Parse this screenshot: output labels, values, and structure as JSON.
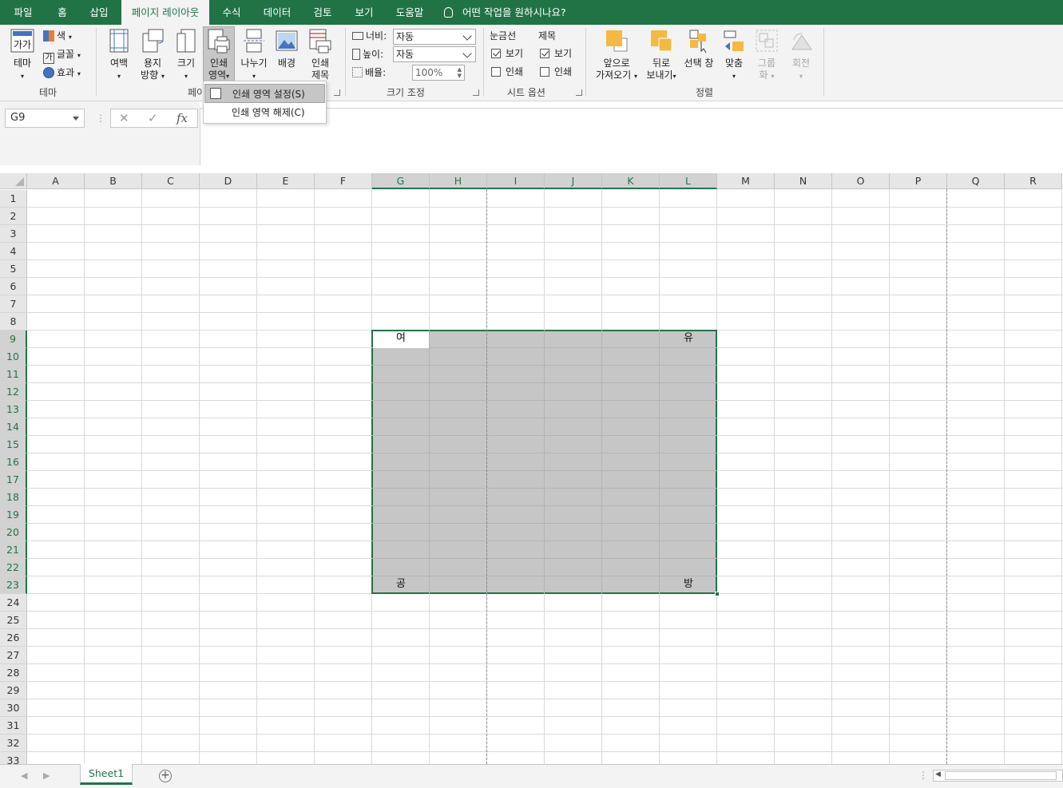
{
  "menu": {
    "tabs": [
      "파일",
      "홈",
      "삽입",
      "페이지 레이아웃",
      "수식",
      "데이터",
      "검토",
      "보기",
      "도움말"
    ],
    "active_tab": "페이지 레이아웃",
    "tell_me": "어떤 작업을 원하시나요?"
  },
  "ribbon": {
    "theme": {
      "button": "테마",
      "colors": "색",
      "fonts": "글꼴",
      "effects": "효과",
      "group": "테마"
    },
    "page_setup": {
      "margins": "여백",
      "orientation_1": "용지",
      "orientation_2": "방향",
      "size": "크기",
      "print_area_1": "인쇄",
      "print_area_2": "영역",
      "breaks": "나누기",
      "background": "배경",
      "print_titles_1": "인쇄",
      "print_titles_2": "제목",
      "group": "페이"
    },
    "scale_to_fit": {
      "width_label": "너비:",
      "width_value": "자동",
      "height_label": "높이:",
      "height_value": "자동",
      "scale_label": "배율:",
      "scale_value": "100%",
      "group": "크기 조정"
    },
    "sheet_options": {
      "gridlines": "눈금선",
      "headings": "제목",
      "view": "보기",
      "print": "인쇄",
      "group": "시트 옵션"
    },
    "arrange": {
      "bring_forward_1": "앞으로",
      "bring_forward_2": "가져오기",
      "send_backward_1": "뒤로",
      "send_backward_2": "보내기",
      "selection_pane": "선택 창",
      "align": "맞춤",
      "group_1": "그룹",
      "group_2": "화",
      "rotate": "회전",
      "group": "정렬"
    }
  },
  "print_area_menu": {
    "set": "인쇄 영역 설정(S)",
    "clear": "인쇄 영역 해제(C)"
  },
  "formula_bar": {
    "name_box": "G9",
    "cancel": "✕",
    "enter": "✓",
    "fx": "fx"
  },
  "grid": {
    "columns": [
      "A",
      "B",
      "C",
      "D",
      "E",
      "F",
      "G",
      "H",
      "I",
      "J",
      "K",
      "L",
      "M",
      "N",
      "O",
      "P",
      "Q",
      "R"
    ],
    "rows": [
      "1",
      "2",
      "3",
      "4",
      "5",
      "6",
      "7",
      "8",
      "9",
      "10",
      "11",
      "12",
      "13",
      "14",
      "15",
      "16",
      "17",
      "18",
      "19",
      "20",
      "21",
      "22",
      "23",
      "24",
      "25",
      "26",
      "27",
      "28",
      "29",
      "30",
      "31",
      "32",
      "33"
    ],
    "cells": {
      "G9": "여",
      "L9": "유",
      "G23": "공",
      "L23": "방"
    }
  },
  "sheet_tabs": {
    "active": "Sheet1",
    "add": "+"
  },
  "colors": {
    "accent": "#217346",
    "selection": "#c6c6c6"
  }
}
